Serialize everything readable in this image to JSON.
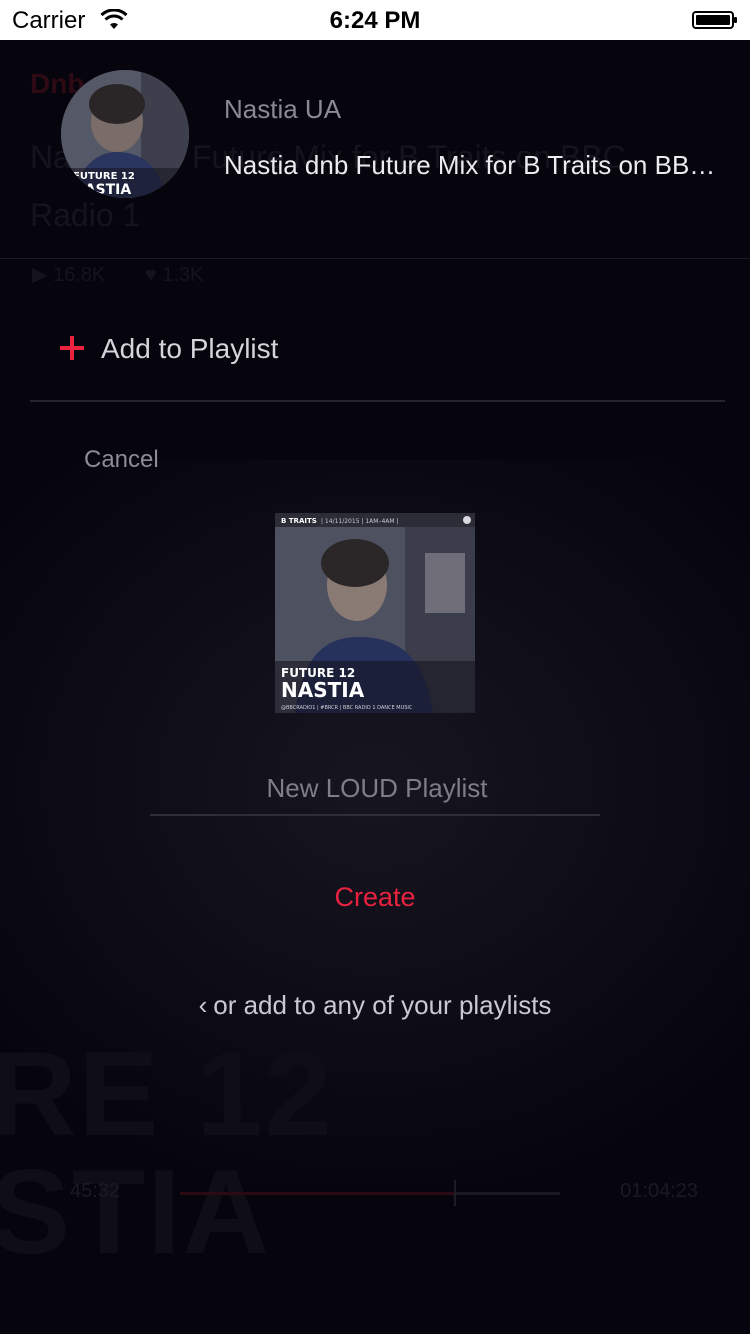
{
  "status_bar": {
    "carrier": "Carrier",
    "time": "6:24 PM",
    "wifi_icon": "wifi-icon",
    "battery_icon": "battery-icon"
  },
  "background_player": {
    "category": "Dnb",
    "title": "Nastia dnb Future Mix for B Traits on BBC Radio 1",
    "plays": "16.8K",
    "likes": "1.3K",
    "art_text": "RE 12\nSTIA",
    "elapsed": "45:32",
    "duration": "01:04:23",
    "progress": 0.72,
    "colors": {
      "accent_dim": "#2c0a14"
    }
  },
  "header": {
    "artist": "Nastia UA",
    "track_title": "Nastia dnb Future Mix for B Traits on BBC Radio 1",
    "avatar_text": "FUTURE 12\nNASTIA"
  },
  "menu": {
    "add_to_playlist": "Add to Playlist",
    "plus_icon": "plus-icon",
    "cancel": "Cancel"
  },
  "new_playlist": {
    "cover_brand": "B TRAITS",
    "cover_title_small": "FUTURE 12",
    "cover_title_big": "NASTIA",
    "placeholder": "New LOUD Playlist",
    "create_label": "Create",
    "any_playlists_label": "or add to any of your playlists",
    "chevron_icon": "chevron-left-icon"
  },
  "colors": {
    "background": "#06050d",
    "accent": "#e8223f",
    "text_secondary": "#8c8c94"
  }
}
